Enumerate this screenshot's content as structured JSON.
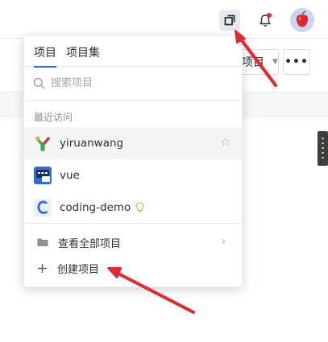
{
  "topbar": {
    "projects_icon": "overlapping-squares-icon",
    "notification_icon": "bell-icon",
    "avatar_icon": "apple-avatar"
  },
  "background": {
    "dropdown_label": "项目",
    "more_label": "•••"
  },
  "dropdown": {
    "tabs": [
      {
        "label": "项目",
        "active": true
      },
      {
        "label": "项目集",
        "active": false
      }
    ],
    "search": {
      "placeholder": "搜索项目",
      "value": ""
    },
    "recent_title": "最近访问",
    "recent_items": [
      {
        "name": "yiruanwang",
        "icon": "yiruanwang-logo",
        "starred": false
      },
      {
        "name": "vue",
        "icon": "vue-project-logo"
      },
      {
        "name": "coding-demo",
        "icon": "coding-logo",
        "badge": "lightbulb-icon"
      }
    ],
    "actions": [
      {
        "label": "查看全部项目",
        "icon": "folder-icon"
      },
      {
        "label": "创建项目",
        "icon": "plus-icon"
      }
    ]
  },
  "colors": {
    "accent": "#2a6ce9",
    "annotation": "#e8262b",
    "notification_dot": "#e42e2e"
  }
}
